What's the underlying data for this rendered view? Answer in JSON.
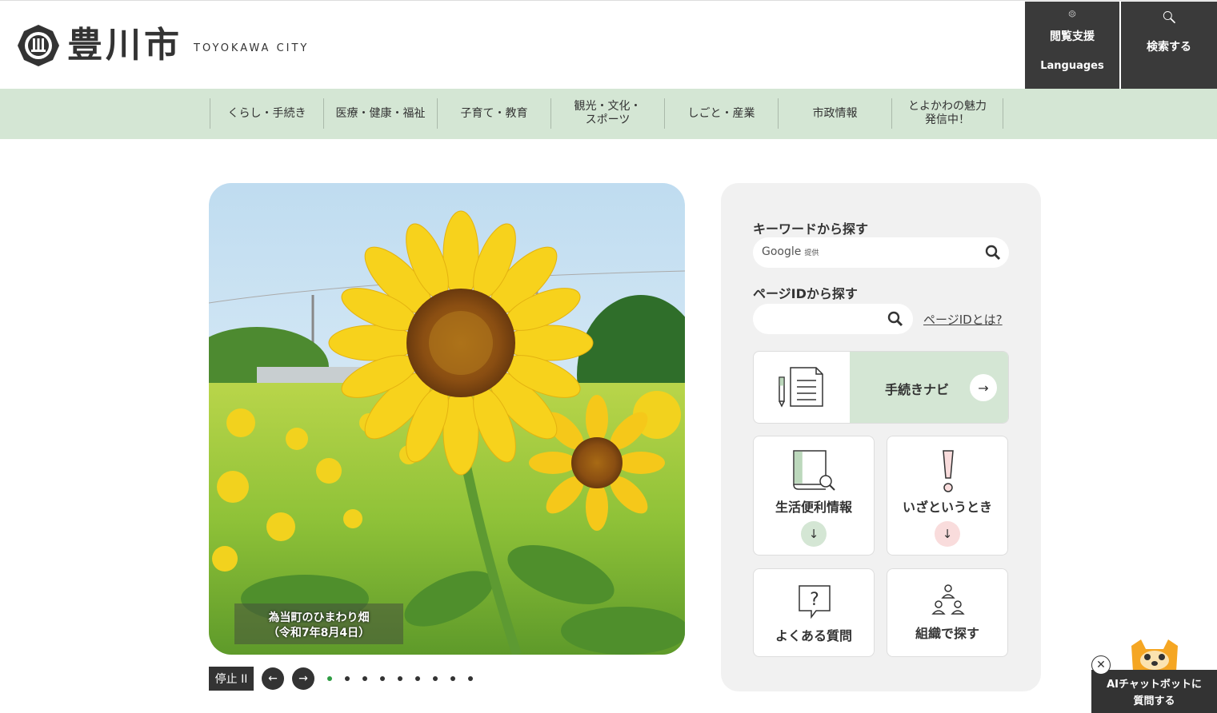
{
  "header": {
    "logo_text": "豊川市",
    "logo_en": "TOYOKAWA CITY",
    "lang_button": {
      "line1": "閲覧支援",
      "line2": "Languages",
      "icon": "gear-icon"
    },
    "search_button": {
      "label": "検索する",
      "icon": "search-icon"
    }
  },
  "gnav": {
    "items": [
      {
        "label": "くらし・手続き"
      },
      {
        "label": "医療・健康・福祉"
      },
      {
        "label": "子育て・教育"
      },
      {
        "label": "観光・文化・\nスポーツ"
      },
      {
        "label": "しごと・産業"
      },
      {
        "label": "市政情報"
      },
      {
        "label": "とよかわの魅力\n発信中！"
      }
    ]
  },
  "slideshow": {
    "caption_line1": "為当町のひまわり畑",
    "caption_line2": "（令和7年8月4日）",
    "stop_label": "停止 II",
    "prev_label": "←",
    "next_label": "→",
    "dot_count": 9,
    "active_dot": 0
  },
  "panel": {
    "keyword_label": "キーワードから探す",
    "google_text": "Google",
    "google_sub": "提供",
    "pageid_label": "ページIDから探す",
    "pageid_link": "ページIDとは?",
    "navi_label": "手続きナビ",
    "navi_arrow": "→",
    "tiles": [
      {
        "label": "生活便利情報",
        "arrow": "↓",
        "color": "#d4e6d4",
        "icon": "book-search-icon"
      },
      {
        "label": "いざというとき",
        "arrow": "↓",
        "color": "#f9dcdc",
        "icon": "exclamation-icon"
      },
      {
        "label": "よくある質問",
        "icon": "question-bubble-icon"
      },
      {
        "label": "組織で探す",
        "icon": "organization-icon"
      }
    ]
  },
  "chat": {
    "line1": "AIチャットボットに",
    "line2": "質問する",
    "close": "✕"
  },
  "colors": {
    "nav_bg": "#d4e6d4",
    "dark": "#3a3a3a",
    "active_dot": "#2e9c43",
    "emergency": "#f9dcdc"
  }
}
